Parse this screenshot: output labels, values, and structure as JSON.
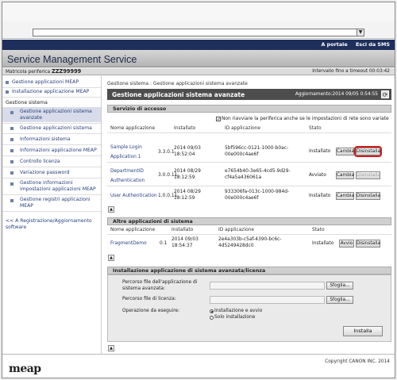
{
  "navbar": {
    "portal": "A portale",
    "logout": "Esci da SMS"
  },
  "app_title": "Service Management Service",
  "infobar": {
    "serial_label": "Matricola periferica",
    "serial": "ZZZ99999",
    "timeout_label": "Intervallo fino a timeout",
    "timeout": "00:03:42"
  },
  "sidebar": {
    "items": [
      {
        "label": "Gestione applicazioni MEAP"
      },
      {
        "label": "Installazione applicazione MEAP"
      }
    ],
    "group_label": "Gestione sistema",
    "sub_items": [
      {
        "label": "Gestione applicazioni sistema avanzate"
      },
      {
        "label": "Gestione applicazioni sistema"
      },
      {
        "label": "Informazioni sistema"
      },
      {
        "label": "Informazioni applicazione MEAP"
      },
      {
        "label": "Controllo licenza"
      },
      {
        "label": "Variazione password"
      },
      {
        "label": "Gestione informazioni impostazioni applicazioni MEAP"
      },
      {
        "label": "Gestione registri applicazioni MEAP"
      }
    ],
    "back_link": "<< A Registrazione/Aggiornamento software"
  },
  "main": {
    "breadcrumb": "Gestione sistema : Gestione applicazioni sistema avanzate",
    "page_title": "Gestione applicazioni sistema avanzate",
    "updated": "Aggiornamento:2014 09/05 0:54:55",
    "access_section": {
      "title": "Servizio di accesso",
      "checkbox_label": "Non riavviare la periferica anche se le impostazioni di rete sono variate",
      "headers": [
        "Nome applicazione",
        "Installato",
        "ID applicazione",
        "Stato"
      ],
      "rows": [
        {
          "name": "Sample Login Application 1",
          "version": "3.3.0.1",
          "installed": "2014 09/03 18:52:04",
          "id": "5bf596cc-0121-1000-b0ac-00e000c4ae6f",
          "status": "Installato",
          "b1": "Cambia",
          "b2": "Disinstalla"
        },
        {
          "name": "DepartmentID Authentication",
          "version": "3.0.0.11",
          "installed": "2014 08/29 18:12:59",
          "id": "e7654b40-3e65-4cd5-9d29-cf4a5a436061a",
          "status": "Avviato",
          "b1": "Cambia",
          "b2": "Disinstalla"
        },
        {
          "name": "User Authentication",
          "version": "1.0.0.11",
          "installed": "2014 08/29 18:12:59",
          "id": "933306fa-013c-1000-984d-00e000c4ae6f",
          "status": "Installato",
          "b1": "Cambia",
          "b2": "Disinstalla"
        }
      ]
    },
    "other_section": {
      "title": "Altre applicazioni di sistema",
      "headers": [
        "Nome applicazione",
        "Installato",
        "ID applicazione",
        "Stato"
      ],
      "rows": [
        {
          "name": "FragmentDemo",
          "version": "0.1",
          "installed": "2014 09/03 18:54:37",
          "id": "2e4a303b-c5af-4390-bc6c-4d5249428dc0",
          "status": "Installato",
          "b1": "Avvio",
          "b2": "Disinstalla"
        }
      ]
    },
    "install_section": {
      "title": "Installazione applicazione di sistema avanzata/licenza",
      "path_label": "Percorso file dell'applicazione di sistema avanzata:",
      "license_label": "Percorso file di licenza:",
      "browse": "Sfoglia...",
      "operation_label": "Operazione da eseguire:",
      "opt1": "Installazione e avvio",
      "opt2": "Solo installazione",
      "install_button": "Installa"
    }
  },
  "footer": {
    "logo": "meap",
    "copyright": "Copyright CANON INC. 2014"
  },
  "collapse_symbol": "▲",
  "colors": {
    "navbar": "#1e2f5c",
    "highlight": "#d31a1a"
  }
}
